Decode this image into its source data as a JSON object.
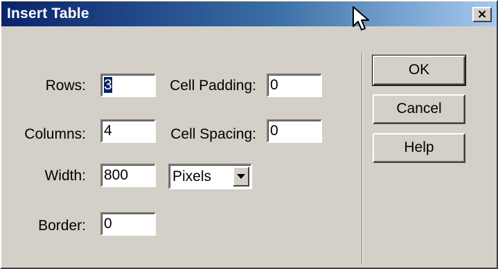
{
  "window": {
    "title": "Insert Table",
    "close_glyph": "×"
  },
  "fields": {
    "rows": {
      "label": "Rows:",
      "value": "3"
    },
    "columns": {
      "label": "Columns:",
      "value": "4"
    },
    "width": {
      "label": "Width:",
      "value": "800"
    },
    "border": {
      "label": "Border:",
      "value": "0"
    },
    "cell_padding": {
      "label": "Cell Padding:",
      "value": "0"
    },
    "cell_spacing": {
      "label": "Cell Spacing:",
      "value": "0"
    }
  },
  "width_unit": {
    "selected": "Pixels"
  },
  "buttons": {
    "ok": "OK",
    "cancel": "Cancel",
    "help": "Help"
  },
  "icons": {
    "close": "close-icon",
    "dropdown": "chevron-down-icon",
    "cursor": "mouse-pointer-icon"
  },
  "colors": {
    "title_start": "#0a246a",
    "title_end": "#a6caf0",
    "face": "#d4d0c8"
  }
}
